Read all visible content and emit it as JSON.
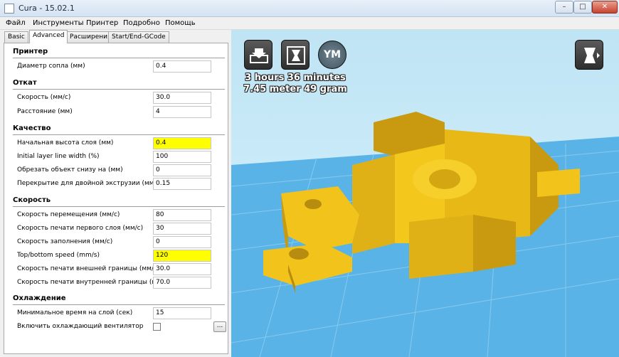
{
  "window": {
    "title": "Cura - 15.02.1",
    "min": "–",
    "max": "□",
    "close": "✕"
  },
  "menu": [
    "Файл",
    "Инструменты",
    "Принтер",
    "Подробно",
    "Помощь"
  ],
  "tabs": [
    "Basic",
    "Advanced",
    "Расширения",
    "Start/End-GCode"
  ],
  "active_tab": "Advanced",
  "sections": {
    "printer": {
      "title": "Принтер",
      "fields": [
        {
          "label": "Диаметр сопла (мм)",
          "value": "0.4"
        }
      ]
    },
    "retraction": {
      "title": "Откат",
      "fields": [
        {
          "label": "Скорость (мм/с)",
          "value": "30.0"
        },
        {
          "label": "Расстояние (мм)",
          "value": "4"
        }
      ]
    },
    "quality": {
      "title": "Качество",
      "fields": [
        {
          "label": "Начальная высота слоя (мм)",
          "value": "0.4",
          "highlight": true
        },
        {
          "label": "Initial layer line width (%)",
          "value": "100"
        },
        {
          "label": "Обрезать объект снизу на (мм)",
          "value": "0"
        },
        {
          "label": "Перекрытие для двойной экструзии (мм)",
          "value": "0.15"
        }
      ]
    },
    "speed": {
      "title": "Скорость",
      "fields": [
        {
          "label": "Скорость перемещения (мм/с)",
          "value": "80"
        },
        {
          "label": "Скорость печати первого слоя (мм/с)",
          "value": "30"
        },
        {
          "label": "Скорость заполнения (мм/с)",
          "value": "0"
        },
        {
          "label": "Top/bottom speed (mm/s)",
          "value": "120",
          "highlight": true
        },
        {
          "label": "Скорость печати внешней границы (мм/с)",
          "value": "30.0"
        },
        {
          "label": "Скорость печати внутренней границы (мм/с)",
          "value": "70.0"
        }
      ]
    },
    "cooling": {
      "title": "Охлаждение",
      "fields": [
        {
          "label": "Минимальное время на слой (сек)",
          "value": "15"
        },
        {
          "label": "Включить охлаждающий вентилятор",
          "checked": false,
          "button": "..."
        }
      ]
    }
  },
  "viewport": {
    "print_time": "3 hours 36 minutes",
    "material": "7.45 meter 49 gram",
    "ym_label": "YM",
    "model_color": "#f2c31a",
    "floor_color": "#5ab3e6"
  },
  "colors": {
    "highlight": "#ffff00",
    "background": "#c3e6f6"
  }
}
